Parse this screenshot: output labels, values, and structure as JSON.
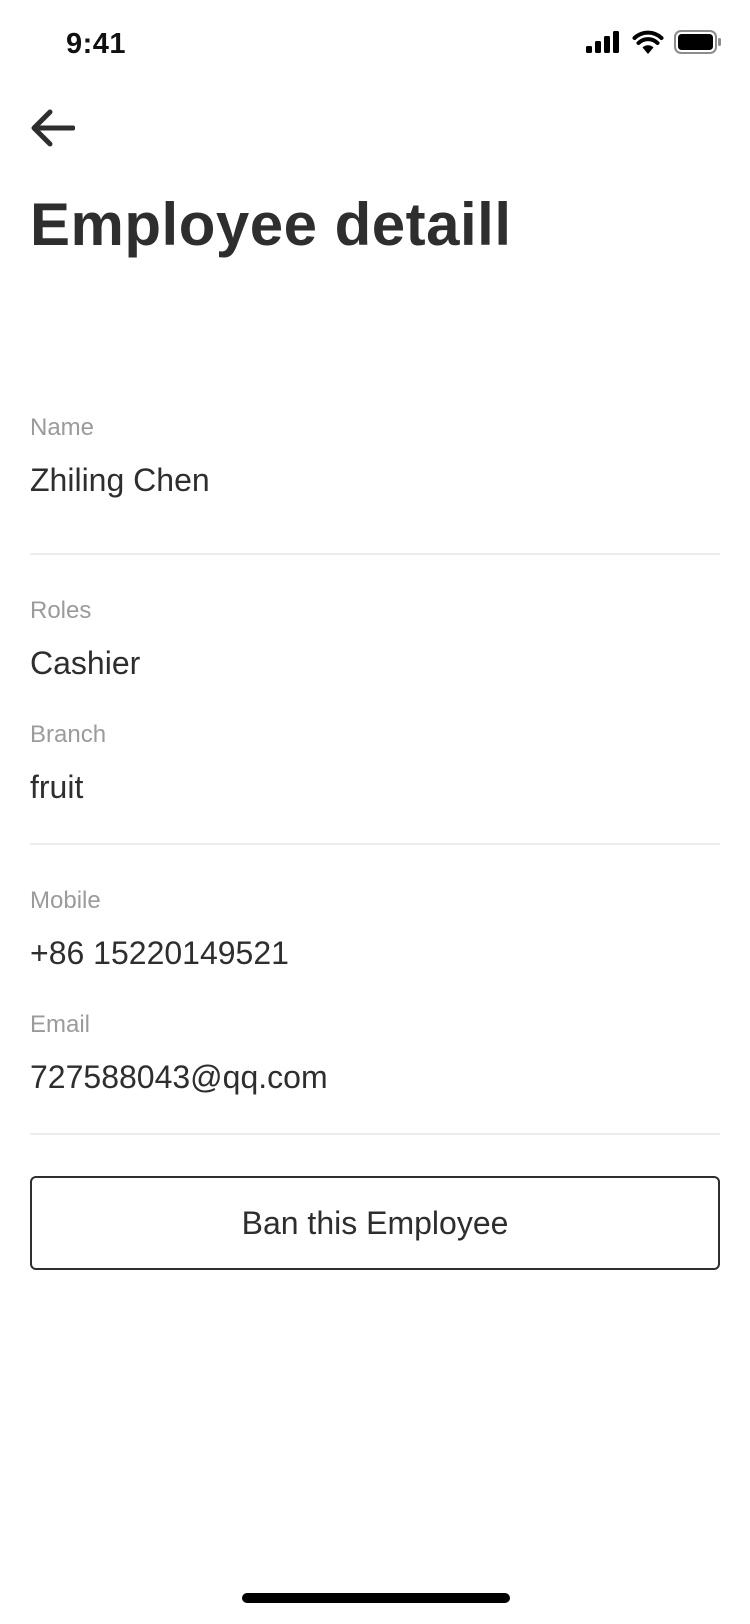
{
  "status_bar": {
    "time": "9:41",
    "icons": [
      "signal-icon",
      "wifi-icon",
      "battery-icon"
    ]
  },
  "header": {
    "back_icon": "arrow-left-icon",
    "title": "Employee detaill"
  },
  "details": {
    "name": {
      "label": "Name",
      "value": "Zhiling Chen"
    },
    "roles": {
      "label": "Roles",
      "value": "Cashier"
    },
    "branch": {
      "label": "Branch",
      "value": "fruit"
    },
    "mobile": {
      "label": "Mobile",
      "value": "+86 15220149521"
    },
    "email": {
      "label": "Email",
      "value": "727588043@qq.com"
    }
  },
  "actions": {
    "ban_label": "Ban this Employee"
  },
  "colors": {
    "text": "#2e2e2e",
    "label": "#9b9b9b",
    "divider": "#ececec",
    "background": "#ffffff"
  }
}
